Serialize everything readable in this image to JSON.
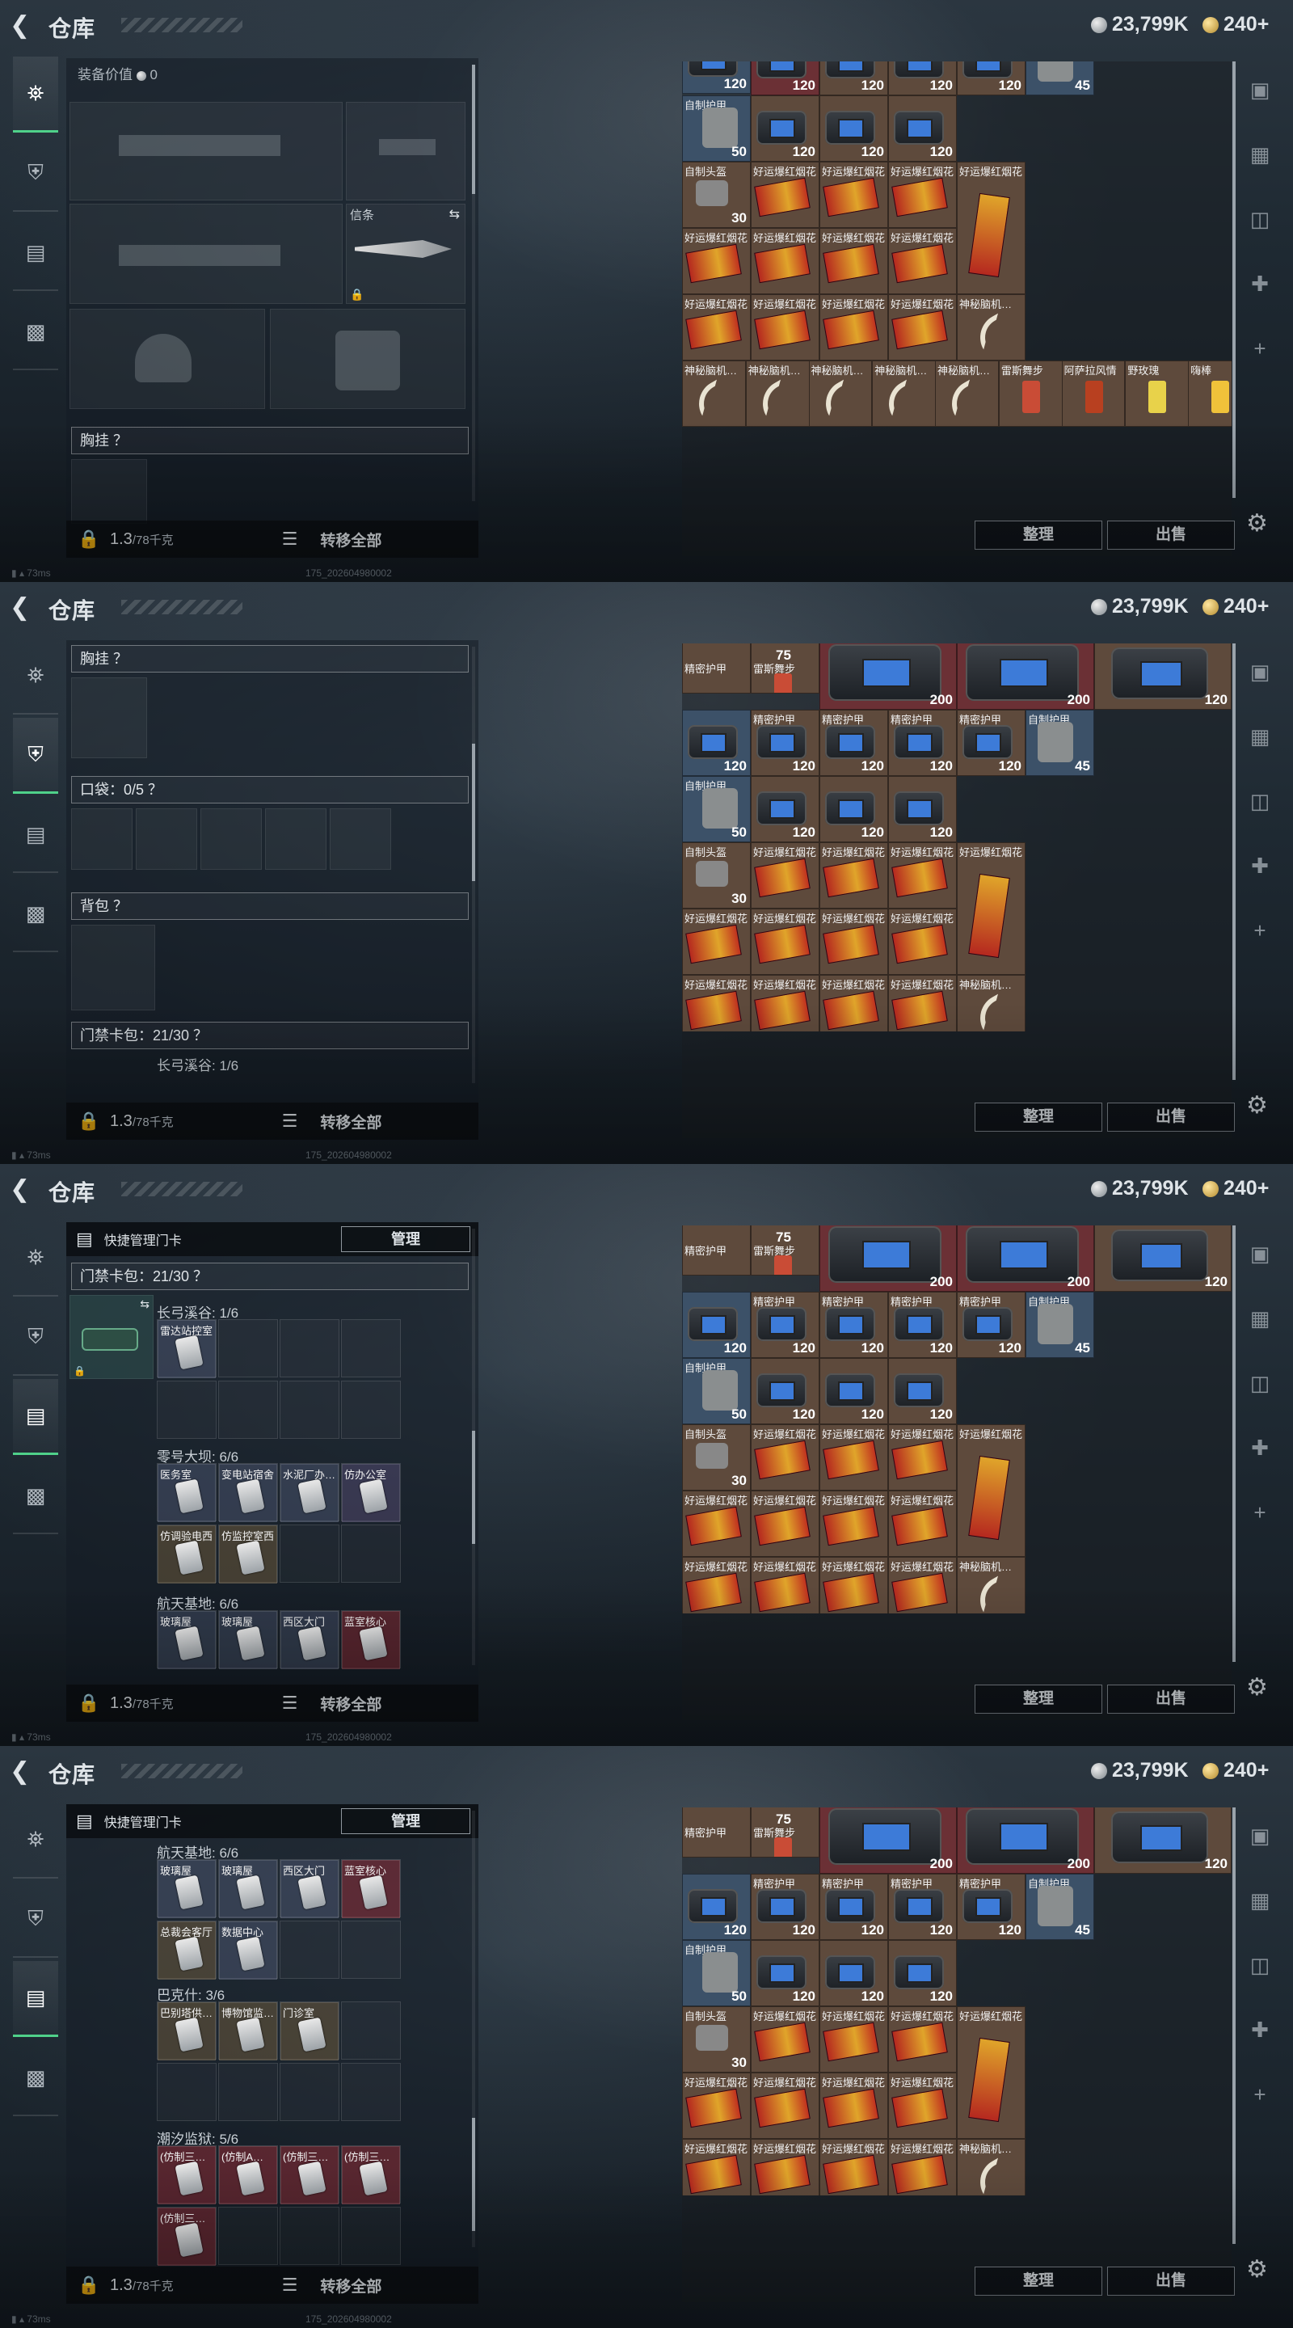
{
  "header": {
    "title": "仓库",
    "silver": "23,799K",
    "gold": "240+"
  },
  "left": {
    "equip_value_label": "装备价值",
    "equip_value": "0",
    "knife_label": "信条",
    "chest_rig": "胸挂 ？",
    "pockets": "口袋：0/5 ？",
    "backpack": "背包 ？",
    "keycard_bag": "门禁卡包：21/30 ？",
    "quick_manage": "快捷管理门卡",
    "manage_button": "管理",
    "weight": "1.3",
    "weight_max": "/78千克",
    "move_all": "转移全部"
  },
  "keycards": {
    "changgong": {
      "title": "长弓溪谷: 1/6",
      "cards": [
        "雷达站控室"
      ]
    },
    "linghao": {
      "title": "零号大坝: 6/6",
      "cards": [
        "医务室",
        "变电站宿舍",
        "水泥厂办…",
        "仿办公室",
        "仿调验电西",
        "仿监控室西"
      ]
    },
    "hangtian": {
      "title": "航天基地: 6/6",
      "cards": [
        "玻璃屋",
        "玻璃屋",
        "西区大门",
        "蓝室核心",
        "总裁会客厅",
        "数据中心"
      ]
    },
    "bakeshi": {
      "title": "巴克什: 3/6",
      "cards": [
        "巴别塔供…",
        "博物馆监…",
        "门诊室"
      ]
    },
    "chaoxi": {
      "title": "潮汐监狱: 5/6",
      "cards": [
        "(仿制三…",
        "(仿制A…",
        "(仿制三…",
        "(仿制三…",
        "(仿制三…"
      ]
    }
  },
  "inventory": {
    "labels": {
      "precise_armor": "精密护甲",
      "homemade_armor": "自制护甲",
      "homemade_helmet": "自制头盔",
      "lucky_firework": "好运爆红烟花",
      "mystic_horn": "神秘脑机…",
      "thunder_dance": "雷斯舞步",
      "aperol": "阿萨拉风情",
      "rose": "野玫瑰",
      "cocktail": "嗨棒"
    },
    "values": {
      "v200": "200",
      "v120": "120",
      "v50": "50",
      "v45": "45",
      "v30": "30",
      "v75": "75"
    },
    "sort_button": "整理",
    "sell_button": "出售"
  },
  "status": {
    "ping": "73ms",
    "version": "175_202604980002"
  }
}
